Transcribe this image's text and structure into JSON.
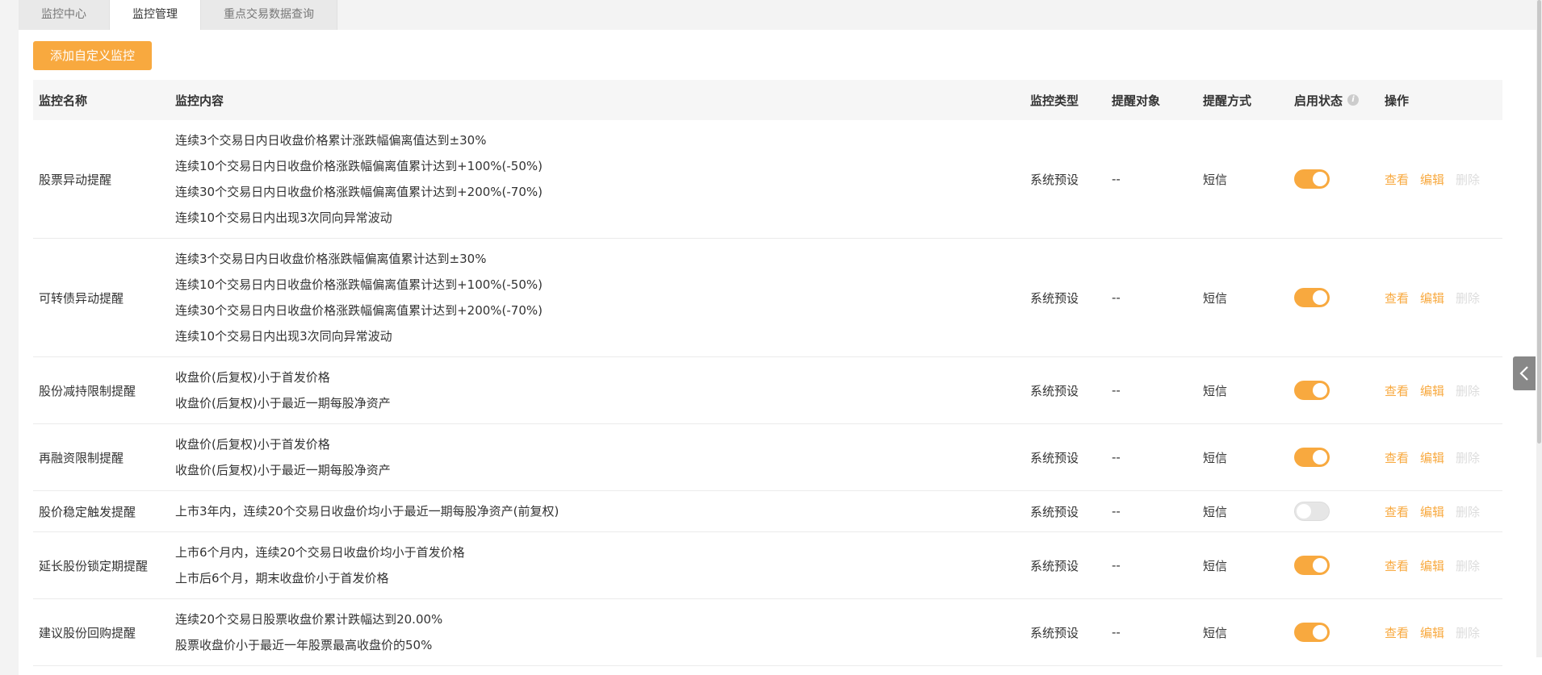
{
  "tabs": [
    {
      "label": "监控中心",
      "active": false
    },
    {
      "label": "监控管理",
      "active": true
    },
    {
      "label": "重点交易数据查询",
      "active": false
    }
  ],
  "add_button": "添加自定义监控",
  "columns": {
    "name": "监控名称",
    "content": "监控内容",
    "type": "监控类型",
    "target": "提醒对象",
    "mode": "提醒方式",
    "status": "启用状态",
    "ops": "操作"
  },
  "ops_labels": {
    "view": "查看",
    "edit": "编辑",
    "delete": "删除"
  },
  "rows": [
    {
      "name": "股票异动提醒",
      "content": [
        "连续3个交易日内日收盘价格累计涨跌幅偏离值达到±30%",
        "连续10个交易日内日收盘价格涨跌幅偏离值累计达到+100%(-50%)",
        "连续30个交易日内日收盘价格涨跌幅偏离值累计达到+200%(-70%)",
        "连续10个交易日内出现3次同向异常波动"
      ],
      "type": "系统预设",
      "target": "--",
      "mode": "短信",
      "enabled": true
    },
    {
      "name": "可转债异动提醒",
      "content": [
        "连续3个交易日内日收盘价格涨跌幅偏离值累计达到±30%",
        "连续10个交易日内日收盘价格涨跌幅偏离值累计达到+100%(-50%)",
        "连续30个交易日内日收盘价格涨跌幅偏离值累计达到+200%(-70%)",
        "连续10个交易日内出现3次同向异常波动"
      ],
      "type": "系统预设",
      "target": "--",
      "mode": "短信",
      "enabled": true
    },
    {
      "name": "股份减持限制提醒",
      "content": [
        "收盘价(后复权)小于首发价格",
        "收盘价(后复权)小于最近一期每股净资产"
      ],
      "type": "系统预设",
      "target": "--",
      "mode": "短信",
      "enabled": true
    },
    {
      "name": "再融资限制提醒",
      "content": [
        "收盘价(后复权)小于首发价格",
        "收盘价(后复权)小于最近一期每股净资产"
      ],
      "type": "系统预设",
      "target": "--",
      "mode": "短信",
      "enabled": true
    },
    {
      "name": "股价稳定触发提醒",
      "content": [
        "上市3年内，连续20个交易日收盘价均小于最近一期每股净资产(前复权)"
      ],
      "type": "系统预设",
      "target": "--",
      "mode": "短信",
      "enabled": false
    },
    {
      "name": "延长股份锁定期提醒",
      "content": [
        "上市6个月内，连续20个交易日收盘价均小于首发价格",
        "上市后6个月，期末收盘价小于首发价格"
      ],
      "type": "系统预设",
      "target": "--",
      "mode": "短信",
      "enabled": true
    },
    {
      "name": "建议股份回购提醒",
      "content": [
        "连续20个交易日股票收盘价累计跌幅达到20.00%",
        "股票收盘价小于最近一年股票最高收盘价的50%"
      ],
      "type": "系统预设",
      "target": "--",
      "mode": "短信",
      "enabled": true
    }
  ],
  "colors": {
    "accent": "#f8a93f",
    "muted": "#dcdcdc"
  }
}
